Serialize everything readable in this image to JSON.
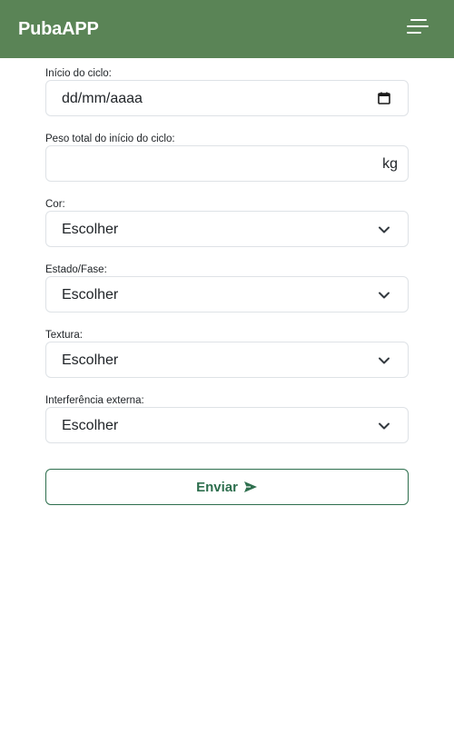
{
  "app": {
    "brand": "PubaAPP",
    "menu_icon": "hamburger-menu-icon"
  },
  "form": {
    "cycle_start": {
      "label": "Início do ciclo:",
      "placeholder": "dd/mm/aaaa",
      "icon": "calendar-icon"
    },
    "total_weight": {
      "label": "Peso total do início do ciclo:",
      "value": "",
      "suffix": "kg"
    },
    "color": {
      "label": "Cor:",
      "selected": "Escolher"
    },
    "state_phase": {
      "label": "Estado/Fase:",
      "selected": "Escolher"
    },
    "texture": {
      "label": "Textura:",
      "selected": "Escolher"
    },
    "external_interference": {
      "label": "Interferência externa:",
      "selected": "Escolher"
    },
    "submit": {
      "label": "Enviar",
      "icon": "send-icon"
    }
  },
  "colors": {
    "navbar": "#5a8456",
    "accent": "#2e6f4e",
    "border": "#dee2e6"
  }
}
